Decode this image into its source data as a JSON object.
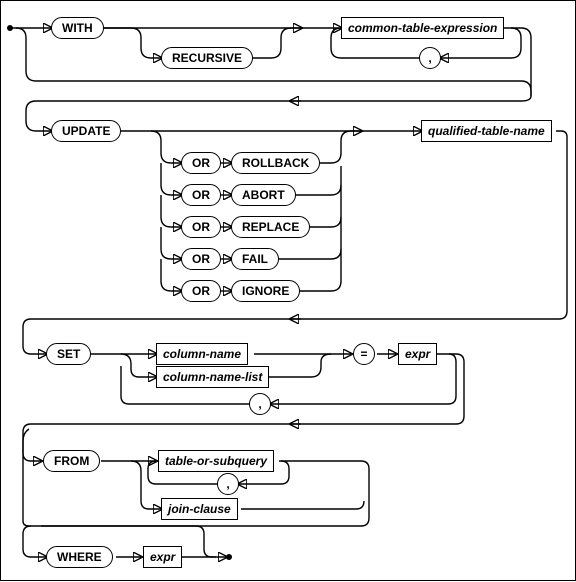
{
  "diagram": {
    "type": "railroad-syntax-diagram",
    "statement": "UPDATE",
    "keywords": {
      "with": "WITH",
      "recursive": "RECURSIVE",
      "update": "UPDATE",
      "or": "OR",
      "rollback": "ROLLBACK",
      "abort": "ABORT",
      "replace": "REPLACE",
      "fail": "FAIL",
      "ignore": "IGNORE",
      "set": "SET",
      "from": "FROM",
      "where": "WHERE"
    },
    "refs": {
      "cte": "common-table-expression",
      "qtn": "qualified-table-name",
      "coln": "column-name",
      "colnl": "column-name-list",
      "expr1": "expr",
      "tos": "table-or-subquery",
      "jc": "join-clause",
      "expr2": "expr"
    },
    "punct": {
      "comma": ",",
      "eq": "="
    },
    "or_alternatives": [
      "ROLLBACK",
      "ABORT",
      "REPLACE",
      "FAIL",
      "IGNORE"
    ]
  }
}
